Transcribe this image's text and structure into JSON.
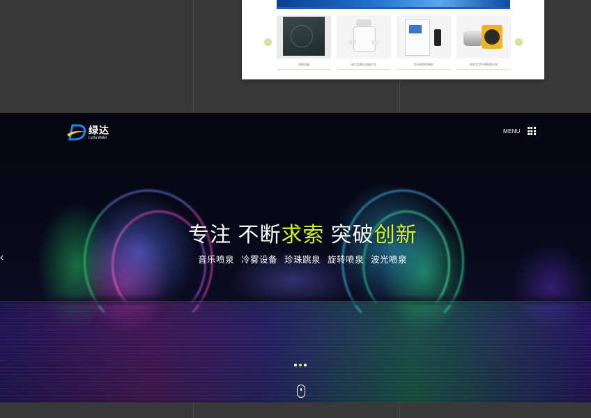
{
  "products": {
    "items": [
      {
        "caption": "喷泉设备",
        "icon": "fountain-photo"
      },
      {
        "caption": "进口品牌过滤器产品",
        "icon": "filter-product"
      },
      {
        "caption": "音乐喷泉控制柜",
        "icon": "control-cabinet"
      },
      {
        "caption": "喷泉专用不锈钢潜水泵",
        "icon": "water-pump"
      }
    ],
    "prev_arrow": "‹",
    "next_arrow": "›",
    "accent": "#cde39c"
  },
  "brand": {
    "name_cn": "绿达",
    "name_en": "LuDa Water",
    "logo_icon": "luda-d-logo-icon",
    "colors": {
      "blue": "#1e88e5",
      "yellow": "#f2d21a"
    }
  },
  "nav": {
    "menu_label": "MENU",
    "menu_icon": "grid-menu-icon"
  },
  "hero": {
    "headline_white_1": "专注 不断",
    "headline_green_1": "求索",
    "headline_white_2": " 突破",
    "headline_green_2": "创新",
    "sub_items": [
      "音乐喷泉",
      "冷雾设备",
      "珍珠跳泉",
      "旋转喷泉",
      "波光喷泉"
    ],
    "highlight_color": "#d9f224",
    "prev_arrow": "‹",
    "slides_total": 3,
    "active_slide": 2,
    "scroll_icon": "mouse-scroll-icon"
  }
}
